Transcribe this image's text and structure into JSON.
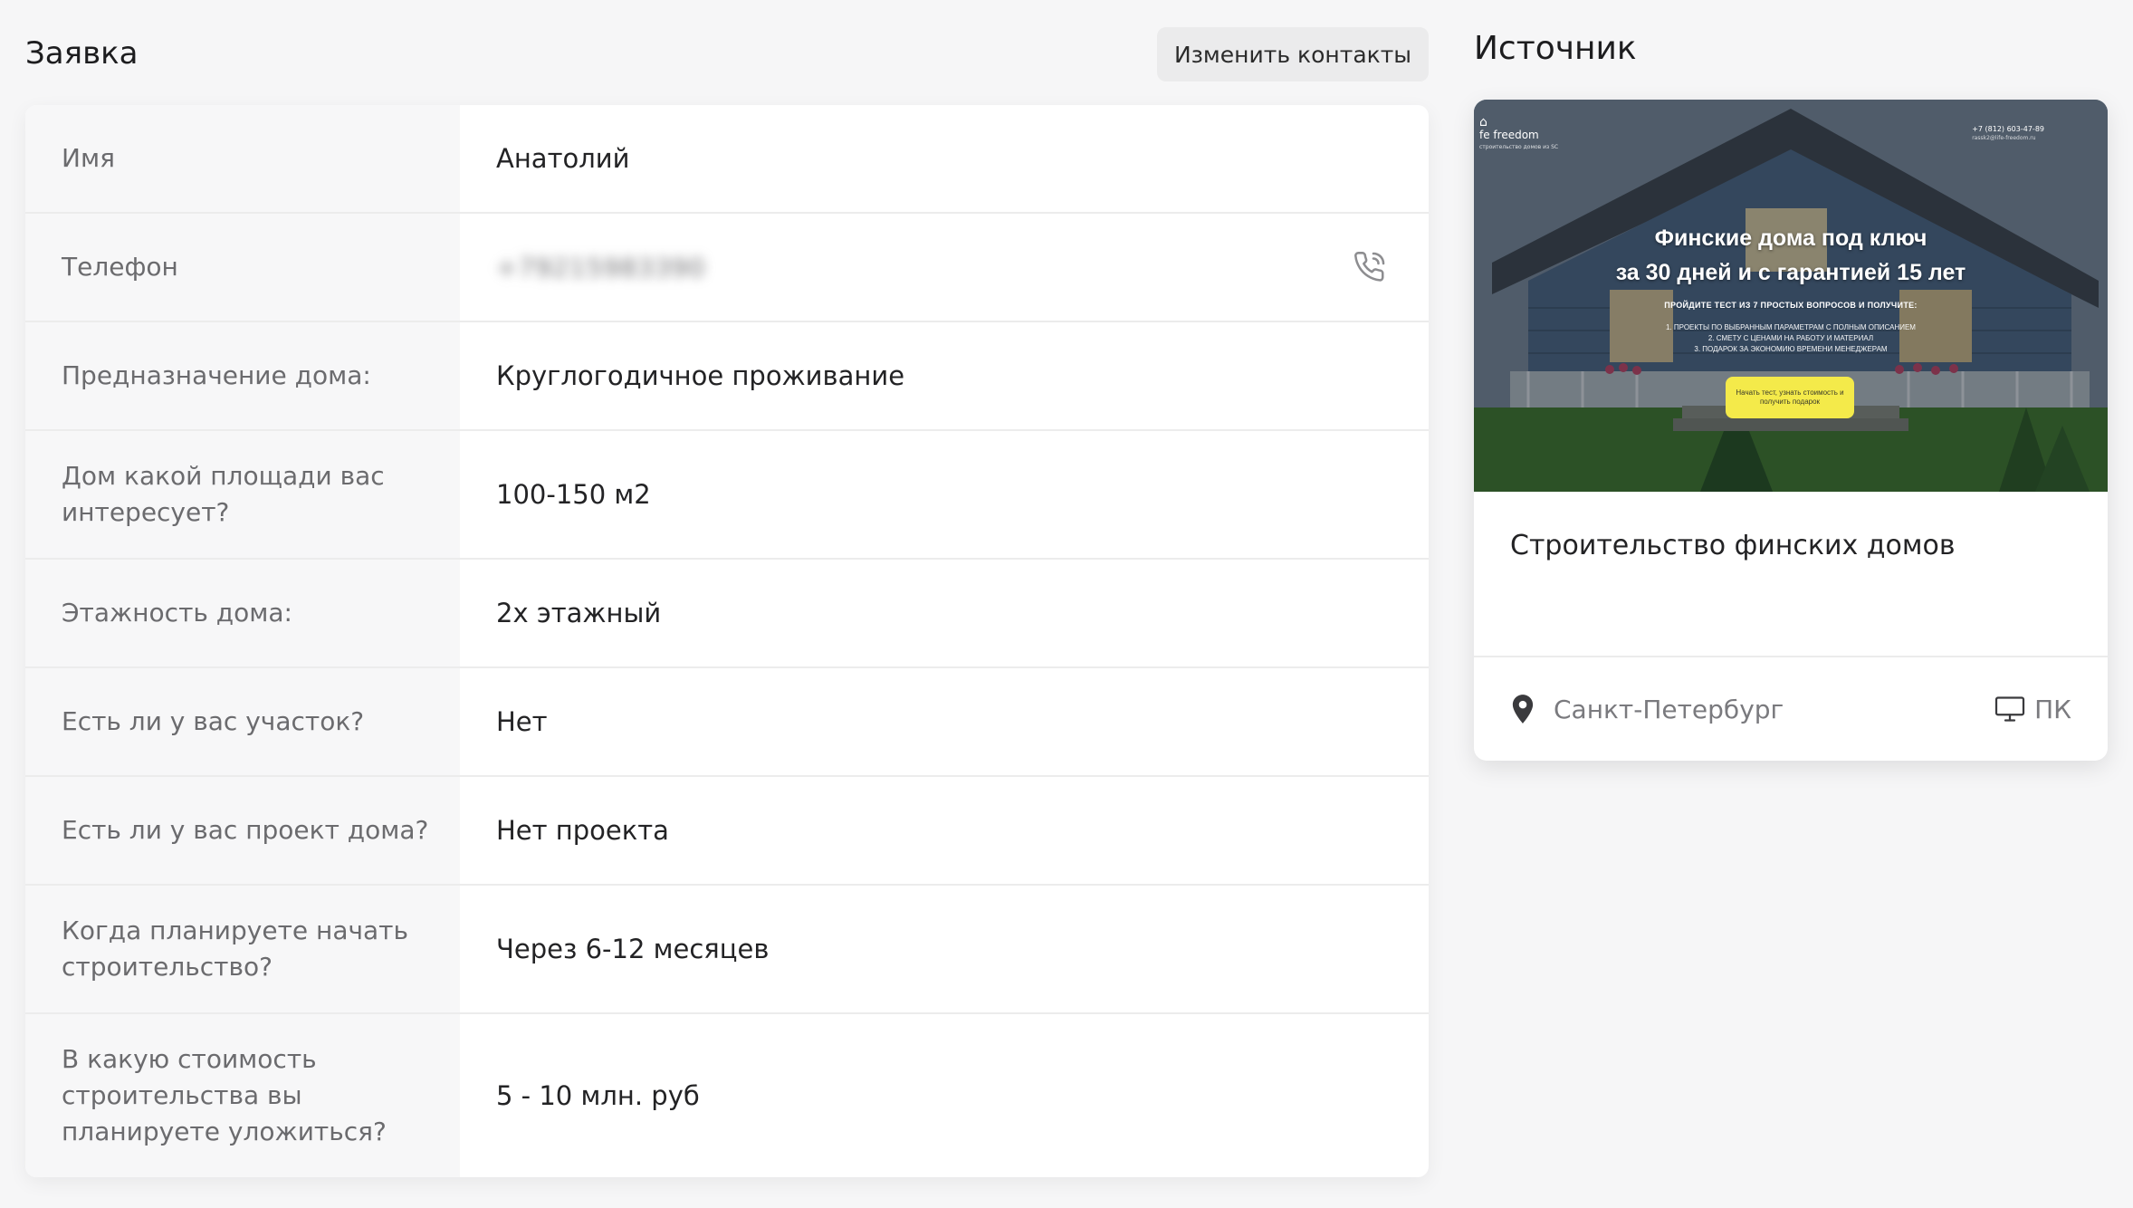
{
  "header": {
    "title": "Заявка",
    "edit_contacts_label": "Изменить контакты"
  },
  "form": {
    "rows": [
      {
        "label": "Имя",
        "value": "Анатолий"
      },
      {
        "label": "Телефон",
        "value": "+79215983390"
      },
      {
        "label": "Предназначение дома:",
        "value": "Круглогодичное проживание"
      },
      {
        "label": "Дом какой площади вас интересует?",
        "value": "100-150 м2"
      },
      {
        "label": "Этажность дома:",
        "value": "2х этажный"
      },
      {
        "label": "Есть ли у вас участок?",
        "value": "Нет"
      },
      {
        "label": "Есть ли у вас проект дома?",
        "value": "Нет проекта"
      },
      {
        "label": "Когда планируете начать строительство?",
        "value": "Через 6-12 месяцев"
      },
      {
        "label": "В какую стоимость строительства вы планируете уложиться?",
        "value": "5 - 10 млн. руб"
      }
    ]
  },
  "source": {
    "title": "Источник",
    "name": "Строительство финских домов",
    "location": "Санкт-Петербург",
    "device": "ПК",
    "preview": {
      "logo": "fe freedom",
      "logo_sub": "строительство домов из SC",
      "phone": "+7 (812) 603-47-89",
      "email": "rassk2@life-freedom.ru",
      "headline_line1": "Финские дома под ключ",
      "headline_line2": "за 30 дней и с гарантией 15 лет",
      "subheadline": "ПРОЙДИТЕ ТЕСТ ИЗ 7 ПРОСТЫХ ВОПРОСОВ И ПОЛУЧИТЕ:",
      "list_item1": "1. ПРОЕКТЫ ПО ВЫБРАННЫМ ПАРАМЕТРАМ С ПОЛНЫМ ОПИСАНИЕМ",
      "list_item2": "2. СМЕТУ С ЦЕНАМИ НА РАБОТУ И МАТЕРИАЛ",
      "list_item3": "3. ПОДАРОК ЗА ЭКОНОМИЮ ВРЕМЕНИ МЕНЕДЖЕРАМ",
      "cta": "Начать тест, узнать стоимость и получить подарок"
    }
  },
  "colors": {
    "background": "#f6f6f7",
    "card": "#ffffff",
    "label_cell": "#f7f7f8",
    "cta_yellow": "#f4ea4a"
  },
  "icons": {
    "phone": "phone-call-icon",
    "location": "map-pin-icon",
    "device": "monitor-icon"
  }
}
